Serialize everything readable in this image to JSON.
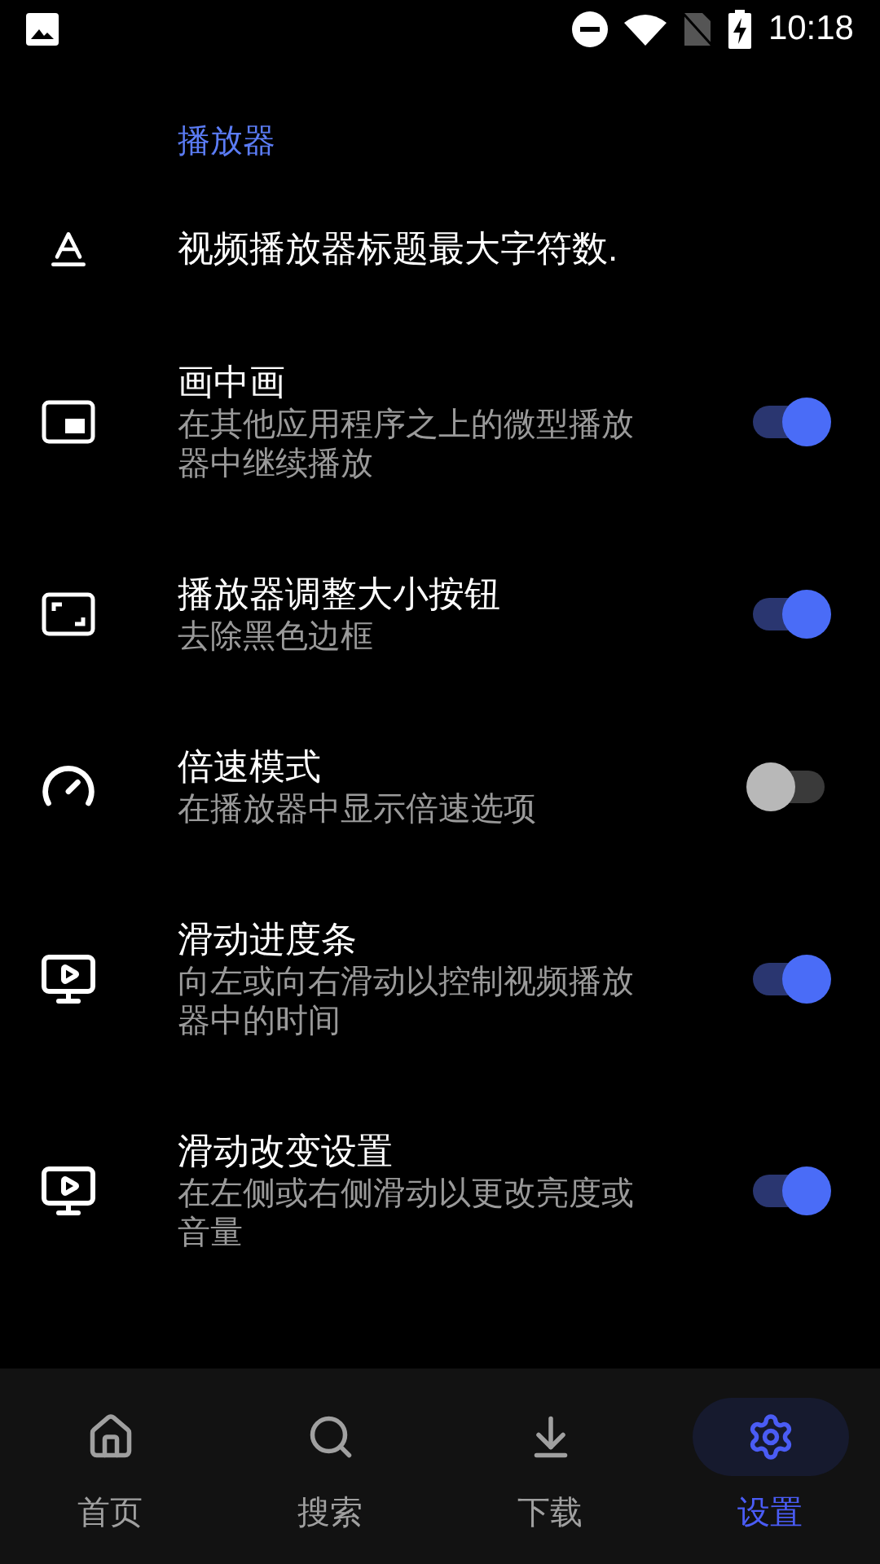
{
  "status_bar": {
    "time": "10:18"
  },
  "section": {
    "title": "播放器"
  },
  "settings": [
    {
      "kind": "plain",
      "title": "视频播放器标题最大字符数."
    },
    {
      "kind": "toggle",
      "title": "画中画",
      "subtitle": "在其他应用程序之上的微型播放器中继续播放",
      "on": true
    },
    {
      "kind": "toggle",
      "title": "播放器调整大小按钮",
      "subtitle": "去除黑色边框",
      "on": true
    },
    {
      "kind": "toggle",
      "title": "倍速模式",
      "subtitle": "在播放器中显示倍速选项",
      "on": false
    },
    {
      "kind": "toggle",
      "title": "滑动进度条",
      "subtitle": "向左或向右滑动以控制视频播放器中的时间",
      "on": true
    },
    {
      "kind": "toggle",
      "title": "滑动改变设置",
      "subtitle": "在左侧或右侧滑动以更改亮度或音量",
      "on": true
    }
  ],
  "nav": [
    {
      "label": "首页",
      "selected": false
    },
    {
      "label": "搜索",
      "selected": false
    },
    {
      "label": "下载",
      "selected": false
    },
    {
      "label": "设置",
      "selected": true
    }
  ]
}
